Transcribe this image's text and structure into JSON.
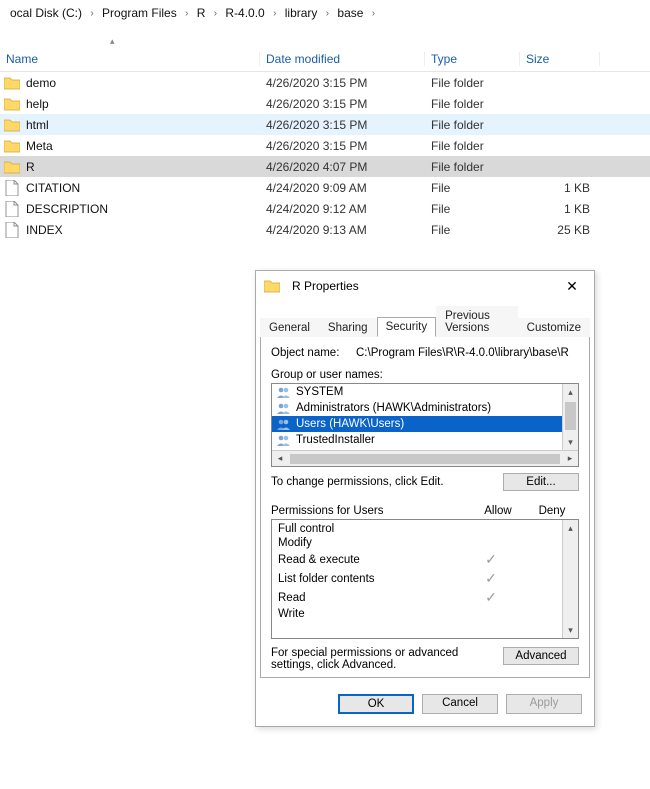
{
  "breadcrumb": {
    "items": [
      "ocal Disk (C:)",
      "Program Files",
      "R",
      "R-4.0.0",
      "library",
      "base"
    ]
  },
  "columns": {
    "name": "Name",
    "date": "Date modified",
    "type": "Type",
    "size": "Size"
  },
  "rows": [
    {
      "name": "demo",
      "date": "4/26/2020 3:15 PM",
      "type": "File folder",
      "size": "",
      "kind": "folder",
      "state": ""
    },
    {
      "name": "help",
      "date": "4/26/2020 3:15 PM",
      "type": "File folder",
      "size": "",
      "kind": "folder",
      "state": ""
    },
    {
      "name": "html",
      "date": "4/26/2020 3:15 PM",
      "type": "File folder",
      "size": "",
      "kind": "folder",
      "state": "highlight"
    },
    {
      "name": "Meta",
      "date": "4/26/2020 3:15 PM",
      "type": "File folder",
      "size": "",
      "kind": "folder",
      "state": ""
    },
    {
      "name": "R",
      "date": "4/26/2020 4:07 PM",
      "type": "File folder",
      "size": "",
      "kind": "folder",
      "state": "selected"
    },
    {
      "name": "CITATION",
      "date": "4/24/2020 9:09 AM",
      "type": "File",
      "size": "1 KB",
      "kind": "file",
      "state": ""
    },
    {
      "name": "DESCRIPTION",
      "date": "4/24/2020 9:12 AM",
      "type": "File",
      "size": "1 KB",
      "kind": "file",
      "state": ""
    },
    {
      "name": "INDEX",
      "date": "4/24/2020 9:13 AM",
      "type": "File",
      "size": "25 KB",
      "kind": "file",
      "state": ""
    }
  ],
  "dialog": {
    "title": "R Properties",
    "tabs": [
      "General",
      "Sharing",
      "Security",
      "Previous Versions",
      "Customize"
    ],
    "active_tab": "Security",
    "object_label": "Object name:",
    "object_value": "C:\\Program Files\\R\\R-4.0.0\\library\\base\\R",
    "group_label": "Group or user names:",
    "groups": [
      {
        "name": "SYSTEM",
        "selected": false
      },
      {
        "name": "Administrators (HAWK\\Administrators)",
        "selected": false
      },
      {
        "name": "Users (HAWK\\Users)",
        "selected": true
      },
      {
        "name": "TrustedInstaller",
        "selected": false
      }
    ],
    "change_hint": "To change permissions, click Edit.",
    "edit_label": "Edit...",
    "perm_title": "Permissions for Users",
    "perm_allow": "Allow",
    "perm_deny": "Deny",
    "permissions": [
      {
        "name": "Full control",
        "allow": false,
        "deny": false
      },
      {
        "name": "Modify",
        "allow": false,
        "deny": false
      },
      {
        "name": "Read & execute",
        "allow": true,
        "deny": false
      },
      {
        "name": "List folder contents",
        "allow": true,
        "deny": false
      },
      {
        "name": "Read",
        "allow": true,
        "deny": false
      },
      {
        "name": "Write",
        "allow": false,
        "deny": false
      }
    ],
    "advanced_hint": "For special permissions or advanced settings, click Advanced.",
    "advanced_label": "Advanced",
    "ok_label": "OK",
    "cancel_label": "Cancel",
    "apply_label": "Apply"
  }
}
